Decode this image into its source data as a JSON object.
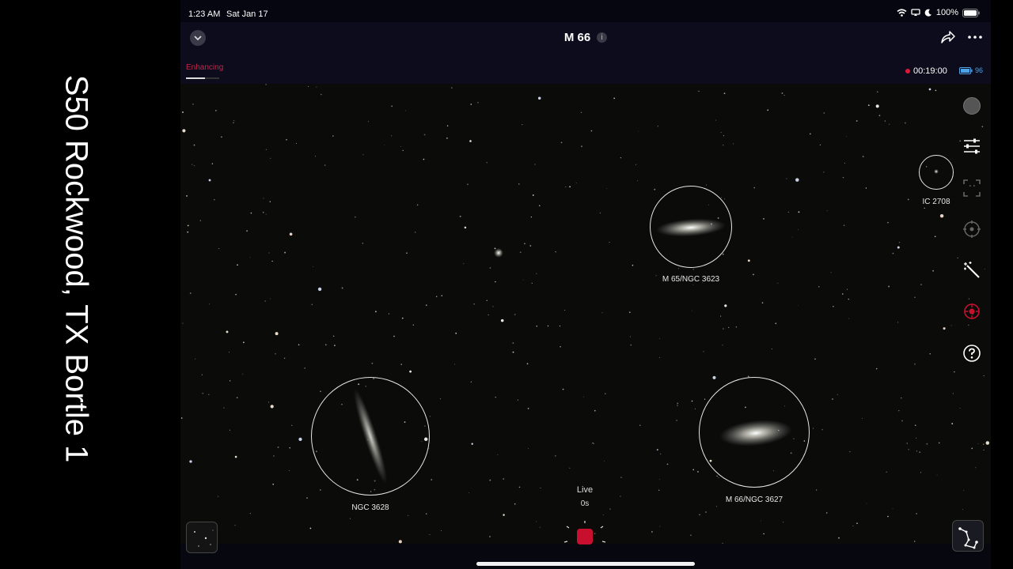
{
  "caption": "S50 Rockwood, TX Bortle 1",
  "status_bar": {
    "time": "1:23 AM",
    "date": "Sat Jan 17",
    "battery": "100%"
  },
  "nav": {
    "title": "M 66",
    "info_icon": "i"
  },
  "subbar": {
    "enhancing_label": "Enhancing",
    "record_time": "00:19:00",
    "battery_level": "96"
  },
  "objects": {
    "ic2708": "IC 2708",
    "m65": "M 65/NGC 3623",
    "ngc3628": "NGC 3628",
    "m66": "M 66/NGC 3627"
  },
  "capture": {
    "mode": "Live",
    "duration": "0s"
  },
  "icons": [
    "chevron-down-icon",
    "info-icon",
    "share-icon",
    "more-icon",
    "sliders-icon",
    "frame-icon",
    "target-icon",
    "magic-wand-icon",
    "red-target-icon",
    "help-icon",
    "constellation-icon"
  ],
  "colors": {
    "accent_red": "#c8102e",
    "record_dot": "#e01838",
    "battery_blue": "#4fa3e8"
  }
}
